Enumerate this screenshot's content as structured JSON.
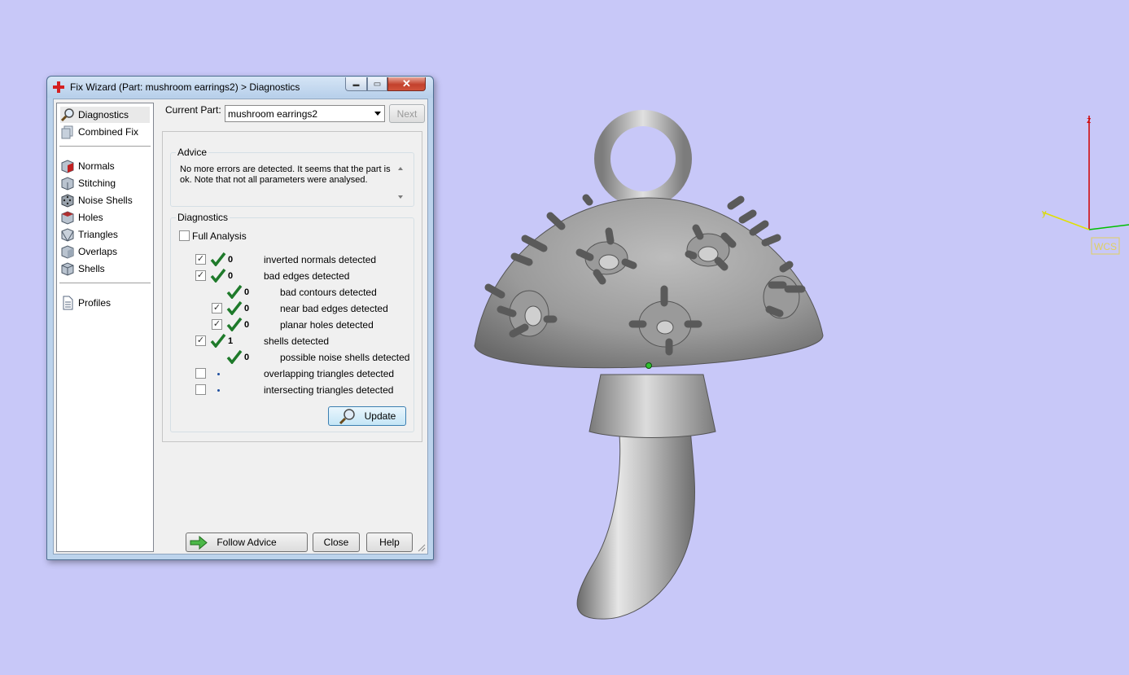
{
  "window": {
    "title": "Fix Wizard (Part: mushroom earrings2) > Diagnostics",
    "minimize_glyph": "▬",
    "maximize_glyph": "▭",
    "close_glyph": "✕"
  },
  "nav": {
    "items": [
      {
        "label": "Diagnostics",
        "icon": "magnifier-icon",
        "selected": true
      },
      {
        "label": "Combined Fix",
        "icon": "stack-icon"
      },
      {
        "label": "Normals",
        "icon": "cube-normals-icon"
      },
      {
        "label": "Stitching",
        "icon": "cube-stitch-icon"
      },
      {
        "label": "Noise Shells",
        "icon": "dice-icon"
      },
      {
        "label": "Holes",
        "icon": "cube-holes-icon"
      },
      {
        "label": "Triangles",
        "icon": "triangle-cube-icon"
      },
      {
        "label": "Overlaps",
        "icon": "cube-overlap-icon"
      },
      {
        "label": "Shells",
        "icon": "cube-shells-icon"
      },
      {
        "label": "Profiles",
        "icon": "document-icon"
      }
    ]
  },
  "current_part": {
    "label": "Current Part:",
    "value": "mushroom earrings2"
  },
  "next_label": "Next",
  "advice": {
    "title": "Advice",
    "text": "No more errors are detected. It seems that the part is ok. Note that not all parameters were analysed."
  },
  "diagnostics": {
    "title": "Diagnostics",
    "full_analysis_label": "Full Analysis",
    "full_analysis_checked": false,
    "rows": [
      {
        "label": "inverted normals detected",
        "count": "0"
      },
      {
        "label": "bad edges detected",
        "count": "0"
      },
      {
        "label": "bad contours detected",
        "count": "0"
      },
      {
        "label": "near bad edges detected",
        "count": "0"
      },
      {
        "label": "planar holes detected",
        "count": "0"
      },
      {
        "label": "shells detected",
        "count": "1"
      },
      {
        "label": "possible noise shells detected",
        "count": "0"
      },
      {
        "label": "overlapping triangles detected",
        "count": ""
      },
      {
        "label": "intersecting triangles detected",
        "count": ""
      }
    ],
    "check_mark": "✓",
    "update_label": "Update"
  },
  "footer": {
    "follow_advice_label": "Follow Advice",
    "close_label": "Close",
    "help_label": "Help"
  },
  "axes": {
    "z_label": "z",
    "y_label": "y",
    "wcs_label": "WCS",
    "colors": {
      "z": "#d00000",
      "y": "#e0e000",
      "x": "#00c000"
    }
  },
  "colors": {
    "background": "#c8c8f8",
    "check_green": "#1e7a2a"
  }
}
